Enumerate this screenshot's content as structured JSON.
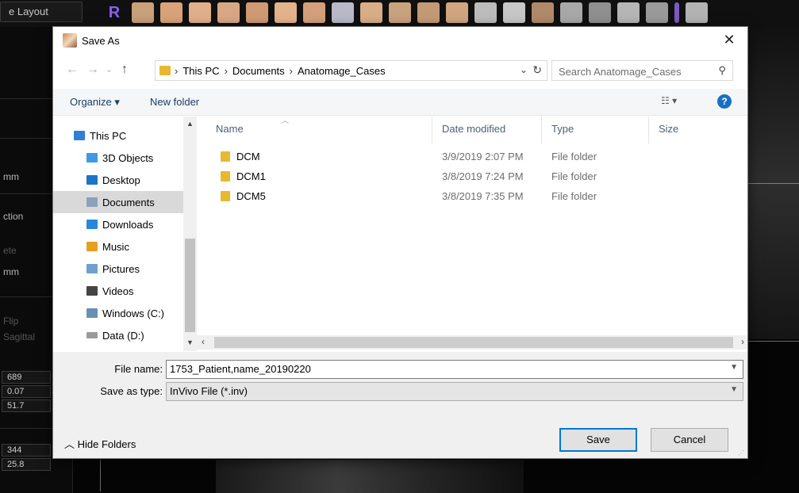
{
  "background": {
    "layout_label": "e Layout",
    "tool_r": "R",
    "sidebar_labels": [
      {
        "text": "mm",
        "dim": false
      },
      {
        "text": "ction",
        "dim": false
      },
      {
        "text": "ete",
        "dim": true
      },
      {
        "text": "mm",
        "dim": false
      },
      {
        "text": "Flip",
        "dim": true
      },
      {
        "text": "Sagittal",
        "dim": true
      }
    ],
    "sidebar_values": [
      "689",
      "0.07",
      "51.7",
      "344",
      "25.8"
    ]
  },
  "dialog": {
    "title": "Save As",
    "close": "✕",
    "nav": {
      "back": "←",
      "forward": "→",
      "recent": "⌄",
      "up": "↑"
    },
    "breadcrumbs": [
      "This PC",
      "Documents",
      "Anatomage_Cases"
    ],
    "crumb_separator": "›",
    "search_placeholder": "Search Anatomage_Cases",
    "toolbar": {
      "organize": "Organize ▾",
      "new_folder": "New folder",
      "view": "☷ ▾",
      "help": "?"
    },
    "nav_pane": [
      {
        "label": "This PC",
        "color": "#2f7fd4",
        "selected": false
      },
      {
        "label": "3D Objects",
        "color": "#3d9ae0",
        "selected": false
      },
      {
        "label": "Desktop",
        "color": "#1e73c8",
        "selected": false
      },
      {
        "label": "Documents",
        "color": "#8aa2bd",
        "selected": true
      },
      {
        "label": "Downloads",
        "color": "#2a86d8",
        "selected": false
      },
      {
        "label": "Music",
        "color": "#e6a020",
        "selected": false
      },
      {
        "label": "Pictures",
        "color": "#6fa0d0",
        "selected": false
      },
      {
        "label": "Videos",
        "color": "#444444",
        "selected": false
      },
      {
        "label": "Windows (C:)",
        "color": "#6a8fb5",
        "selected": false
      },
      {
        "label": "Data (D:)",
        "color": "#9a9a9a",
        "selected": false
      }
    ],
    "columns": {
      "name": "Name",
      "date": "Date modified",
      "type": "Type",
      "size": "Size"
    },
    "files": [
      {
        "name": "DCM",
        "date": "3/9/2019 2:07 PM",
        "type": "File folder"
      },
      {
        "name": "DCM1",
        "date": "3/8/2019 7:24 PM",
        "type": "File folder"
      },
      {
        "name": "DCM5",
        "date": "3/8/2019 7:35 PM",
        "type": "File folder"
      }
    ],
    "file_name_label": "File name:",
    "file_name_value": "1753_Patient,name_20190220",
    "save_type_label": "Save as type:",
    "save_type_value": "InVivo File (*.inv)",
    "hide_folders": "Hide Folders",
    "save_button": "Save",
    "cancel_button": "Cancel"
  }
}
